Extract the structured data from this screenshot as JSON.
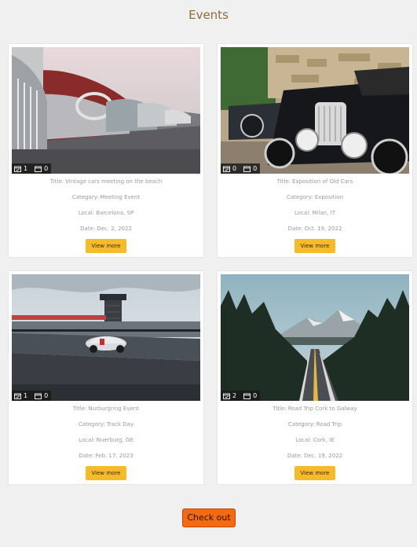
{
  "page": {
    "title": "Events"
  },
  "labels": {
    "title": "Title:",
    "category": "Category:",
    "local": "Local:",
    "date": "Date:"
  },
  "events": [
    {
      "title": "Vintage cars meeting on the beach",
      "category": "Meeting Event",
      "local": "Barcelona, SP",
      "date": "Dec. 2, 2022",
      "count_a": "1",
      "count_b": "0",
      "button": "View more"
    },
    {
      "title": "Exposition of Old Cars",
      "category": "Exposition",
      "local": "Milan, IT",
      "date": "Oct. 19, 2022",
      "count_a": "0",
      "count_b": "0",
      "button": "View more"
    },
    {
      "title": "Nurburgring Event",
      "category": "Track Day",
      "local": "Nuerburg, GE",
      "date": "Feb. 17, 2023",
      "count_a": "1",
      "count_b": "0",
      "button": "View more"
    },
    {
      "title": "Road Trip Cork to Galway",
      "category": "Road Trip",
      "local": "Cork, IE",
      "date": "Dec. 19, 2022",
      "count_a": "2",
      "count_b": "0",
      "button": "View more"
    }
  ],
  "checkout": {
    "label": "Check out"
  },
  "icons": {
    "count_a": "calendar-check-icon",
    "count_b": "calendar-icon"
  },
  "colors": {
    "button": "#f5bb2b",
    "checkout": "#f46a12",
    "title": "#8a6d3b"
  }
}
